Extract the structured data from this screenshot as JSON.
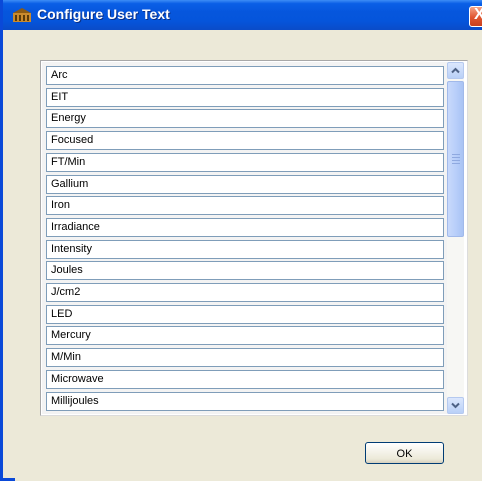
{
  "window": {
    "title": "Configure User Text",
    "close_glyph": "X",
    "icon": "app-building-icon"
  },
  "list": {
    "items": [
      "Arc",
      "EIT",
      "Energy",
      "Focused",
      "FT/Min",
      "Gallium",
      "Iron",
      "Irradiance",
      "Intensity",
      "Joules",
      "J/cm2",
      "LED",
      "Mercury",
      "M/Min",
      "Microwave",
      "Millijoules"
    ],
    "scroll_up_icon": "chevron-up-icon",
    "scroll_down_icon": "chevron-down-icon"
  },
  "buttons": {
    "ok_label": "OK"
  },
  "colors": {
    "titlebar": "#0656dd",
    "window_bg": "#ece9d8",
    "close": "#e0552f",
    "item_border": "#7f9db9"
  }
}
